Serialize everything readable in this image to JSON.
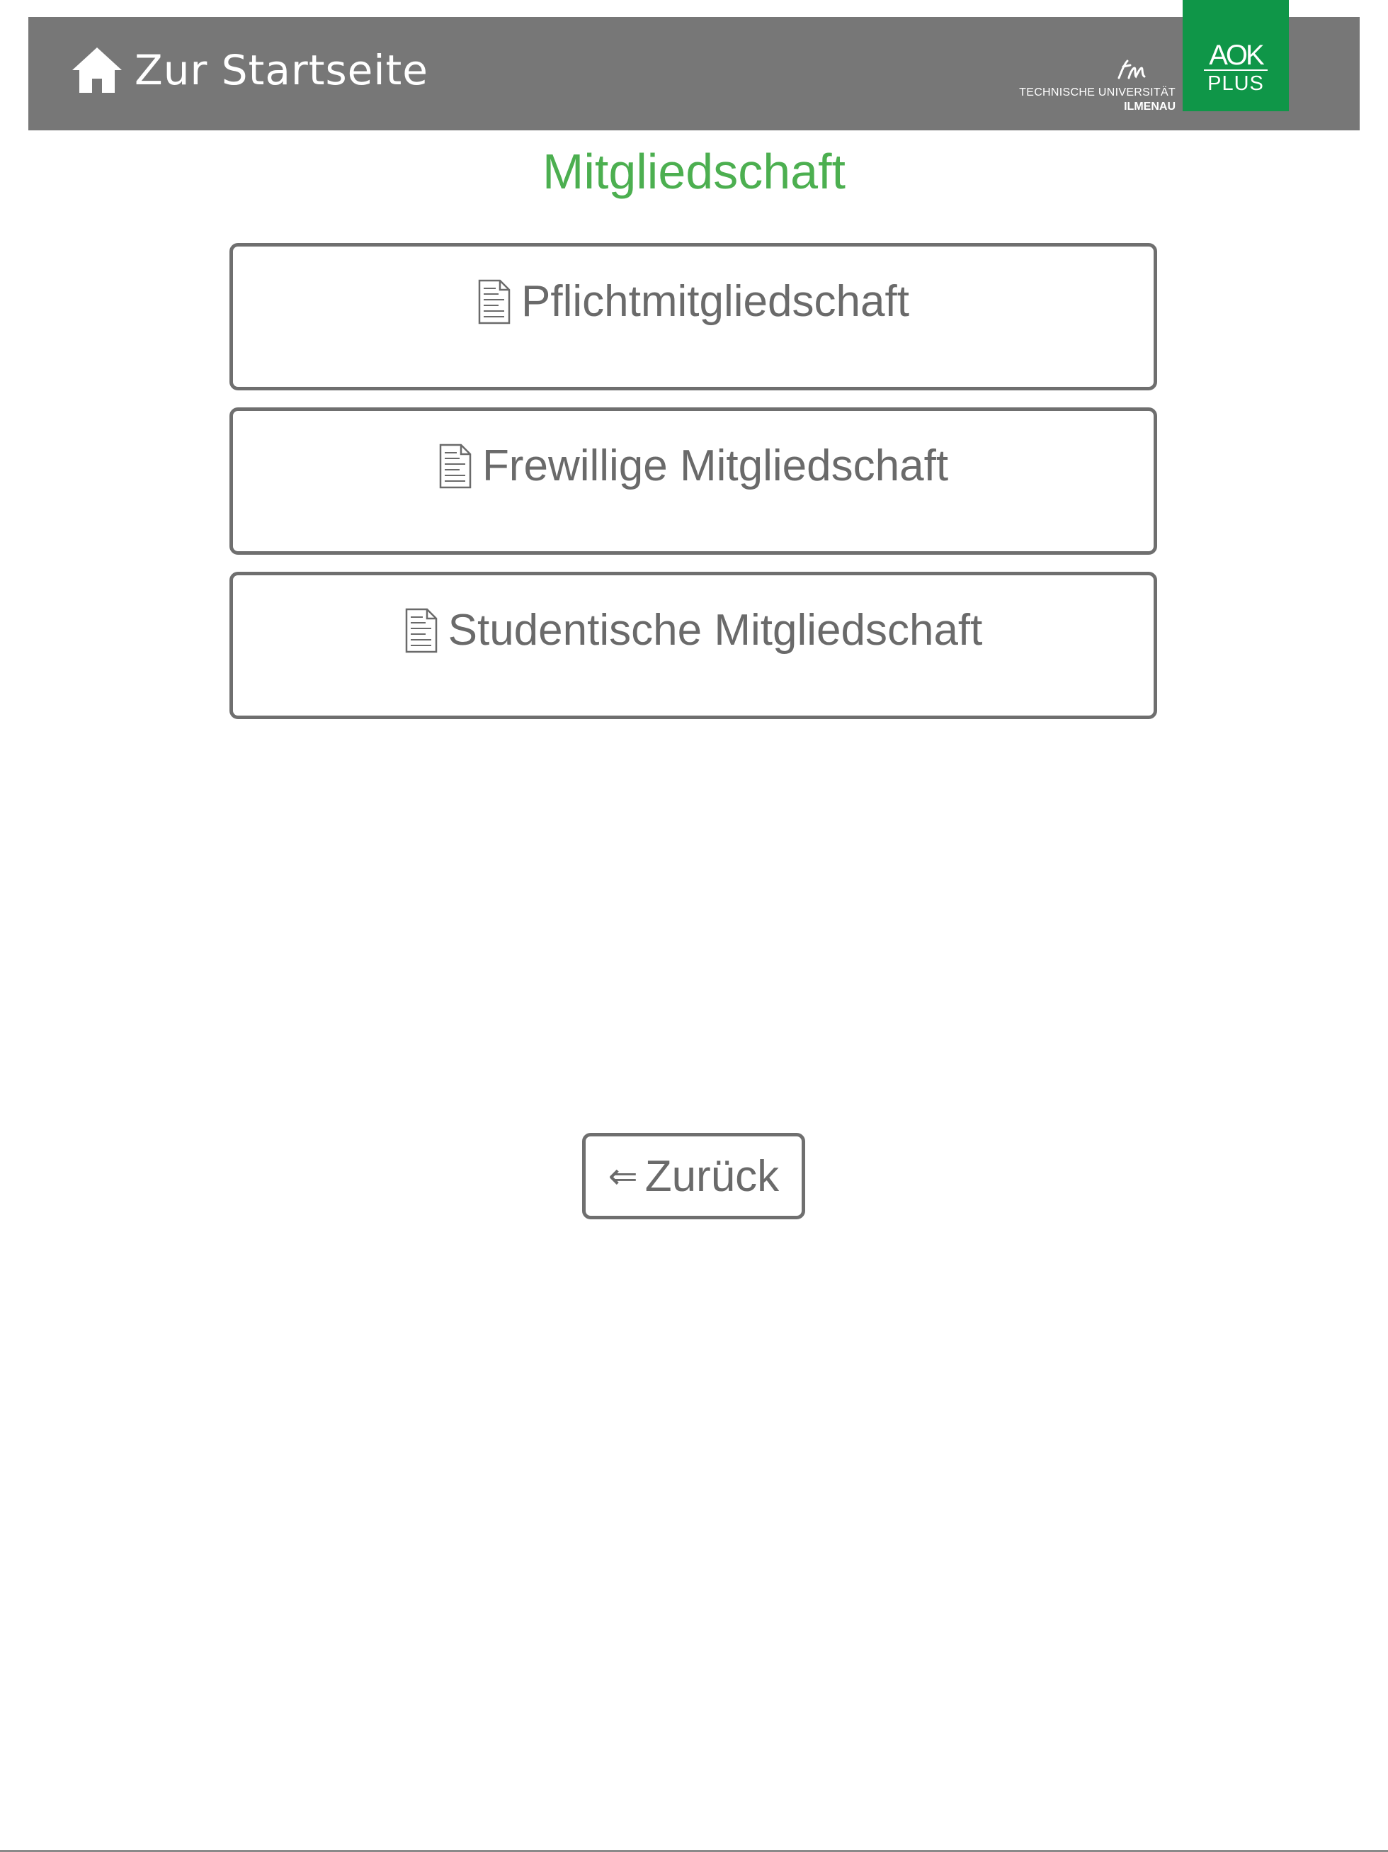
{
  "header": {
    "home_label": "Zur Startseite",
    "home_icon": "home-icon",
    "tu_logo": {
      "line1": "TECHNISCHE UNIVERSITÄT",
      "line2": "ILMENAU"
    },
    "aok_logo": {
      "top": "AOK",
      "bottom": "PLUS",
      "background": "#0f9648"
    },
    "background": "#777777"
  },
  "main": {
    "title": "Mitgliedschaft",
    "title_color": "#4caf50",
    "options": [
      {
        "label": "Pflichtmitgliedschaft",
        "icon": "document-icon"
      },
      {
        "label": "Frewillige Mitgliedschaft",
        "icon": "document-icon"
      },
      {
        "label": "Studentische Mitgliedschaft",
        "icon": "document-icon"
      }
    ]
  },
  "footer": {
    "back_arrow": "⇐",
    "back_label": "Zurück"
  }
}
